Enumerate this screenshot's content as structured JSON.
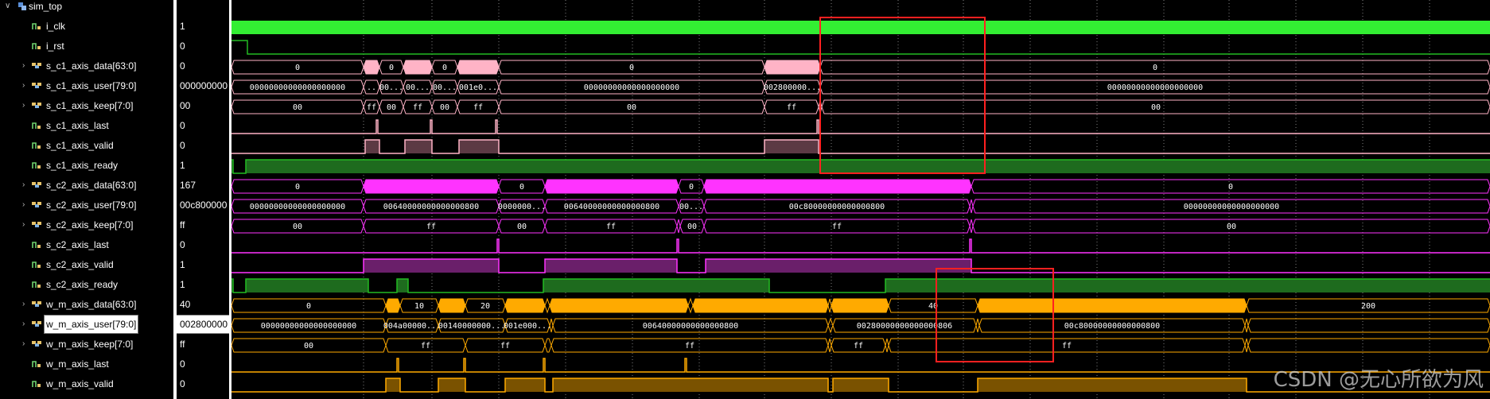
{
  "scope": {
    "name": "sim_top"
  },
  "signals": [
    {
      "name": "i_clk",
      "value": "1",
      "type": "bit",
      "expandable": false
    },
    {
      "name": "i_rst",
      "value": "0",
      "type": "bit",
      "expandable": false
    },
    {
      "name": "s_c1_axis_data[63:0]",
      "value": "0",
      "type": "bus",
      "expandable": true
    },
    {
      "name": "s_c1_axis_user[79:0]",
      "value": "000000000",
      "type": "bus",
      "expandable": true
    },
    {
      "name": "s_c1_axis_keep[7:0]",
      "value": "00",
      "type": "bus",
      "expandable": true
    },
    {
      "name": "s_c1_axis_last",
      "value": "0",
      "type": "bit",
      "expandable": false
    },
    {
      "name": "s_c1_axis_valid",
      "value": "0",
      "type": "bit",
      "expandable": false
    },
    {
      "name": "s_c1_axis_ready",
      "value": "1",
      "type": "bit",
      "expandable": false
    },
    {
      "name": "s_c2_axis_data[63:0]",
      "value": "167",
      "type": "bus",
      "expandable": true
    },
    {
      "name": "s_c2_axis_user[79:0]",
      "value": "00c800000",
      "type": "bus",
      "expandable": true
    },
    {
      "name": "s_c2_axis_keep[7:0]",
      "value": "ff",
      "type": "bus",
      "expandable": true
    },
    {
      "name": "s_c2_axis_last",
      "value": "0",
      "type": "bit",
      "expandable": false
    },
    {
      "name": "s_c2_axis_valid",
      "value": "1",
      "type": "bit",
      "expandable": false
    },
    {
      "name": "s_c2_axis_ready",
      "value": "1",
      "type": "bit",
      "expandable": false
    },
    {
      "name": "w_m_axis_data[63:0]",
      "value": "40",
      "type": "bus",
      "expandable": true
    },
    {
      "name": "w_m_axis_user[79:0]",
      "value": "002800000",
      "type": "bus",
      "expandable": true,
      "selected": true
    },
    {
      "name": "w_m_axis_keep[7:0]",
      "value": "ff",
      "type": "bus",
      "expandable": true
    },
    {
      "name": "w_m_axis_last",
      "value": "0",
      "type": "bit",
      "expandable": false
    },
    {
      "name": "w_m_axis_valid",
      "value": "0",
      "type": "bit",
      "expandable": false
    }
  ],
  "colors": {
    "clk": "#33ee33",
    "green": "#22bb22",
    "green_fill": "#1e6b1e",
    "pink": "#ffb3c6",
    "pink_fill": "#5c3a44",
    "magenta": "#ff33ff",
    "magenta_fill": "#6a1f6a",
    "orange": "#ffaa00",
    "orange_fill": "#7a5200",
    "grid": "#808080",
    "highlight": "#ff2020"
  },
  "waves": [
    {
      "row": 0,
      "kind": "clock"
    },
    {
      "row": 1,
      "kind": "bit",
      "color": "green",
      "segs": [
        [
          0,
          20,
          1
        ],
        [
          20,
          1582,
          0
        ]
      ]
    },
    {
      "row": 2,
      "kind": "bus",
      "color": "pink",
      "segs": [
        [
          0,
          166,
          "0",
          0
        ],
        [
          166,
          186,
          "",
          1
        ],
        [
          186,
          216,
          "0",
          0
        ],
        [
          216,
          252,
          "",
          1
        ],
        [
          252,
          284,
          "0",
          0
        ],
        [
          284,
          336,
          "",
          1
        ],
        [
          336,
          670,
          "0",
          0
        ],
        [
          670,
          740,
          "",
          1
        ],
        [
          740,
          1582,
          "0",
          0
        ]
      ]
    },
    {
      "row": 3,
      "kind": "bus",
      "color": "pink",
      "segs": [
        [
          0,
          166,
          "00000000000000000000",
          0
        ],
        [
          166,
          186,
          "..",
          0
        ],
        [
          186,
          216,
          "00...",
          0
        ],
        [
          216,
          252,
          "00...",
          0
        ],
        [
          252,
          284,
          "00...",
          0
        ],
        [
          284,
          336,
          "001e0...",
          0
        ],
        [
          336,
          670,
          "00000000000000000000",
          0
        ],
        [
          670,
          740,
          "002800000...",
          0
        ],
        [
          740,
          1582,
          "00000000000000000000",
          0
        ]
      ]
    },
    {
      "row": 4,
      "kind": "bus",
      "color": "pink",
      "segs": [
        [
          0,
          166,
          "00",
          0
        ],
        [
          166,
          186,
          "ff",
          0
        ],
        [
          186,
          216,
          "00",
          0
        ],
        [
          216,
          252,
          "ff",
          0
        ],
        [
          252,
          284,
          "00",
          0
        ],
        [
          284,
          336,
          "ff",
          0
        ],
        [
          336,
          670,
          "00",
          0
        ],
        [
          670,
          738,
          "ff",
          0
        ],
        [
          738,
          742,
          "",
          0
        ],
        [
          742,
          1582,
          "00",
          0
        ]
      ]
    },
    {
      "row": 5,
      "kind": "bit",
      "color": "pink",
      "segs": [
        [
          0,
          182,
          0
        ],
        [
          182,
          184,
          1
        ],
        [
          184,
          250,
          0
        ],
        [
          250,
          252,
          1
        ],
        [
          252,
          332,
          0
        ],
        [
          332,
          334,
          1
        ],
        [
          334,
          736,
          0
        ],
        [
          736,
          738,
          1
        ],
        [
          738,
          1582,
          0
        ]
      ]
    },
    {
      "row": 6,
      "kind": "bit",
      "color": "pink",
      "fill": "pink_fill",
      "segs": [
        [
          0,
          168,
          0
        ],
        [
          168,
          186,
          1
        ],
        [
          186,
          218,
          0
        ],
        [
          218,
          252,
          1
        ],
        [
          252,
          286,
          0
        ],
        [
          286,
          336,
          1
        ],
        [
          336,
          670,
          0
        ],
        [
          670,
          738,
          1
        ],
        [
          738,
          1582,
          0
        ]
      ]
    },
    {
      "row": 7,
      "kind": "bit",
      "color": "green",
      "fill": "green_fill",
      "segs": [
        [
          0,
          2,
          1
        ],
        [
          2,
          18,
          0
        ],
        [
          18,
          1582,
          1
        ]
      ]
    },
    {
      "row": 8,
      "kind": "bus",
      "color": "magenta",
      "segs": [
        [
          0,
          166,
          "0",
          0
        ],
        [
          166,
          336,
          "",
          1
        ],
        [
          336,
          394,
          "0",
          0
        ],
        [
          394,
          562,
          "",
          1
        ],
        [
          562,
          594,
          "0",
          0
        ],
        [
          594,
          930,
          "",
          1
        ],
        [
          930,
          1582,
          "0",
          0
        ]
      ]
    },
    {
      "row": 9,
      "kind": "bus",
      "color": "magenta",
      "segs": [
        [
          0,
          166,
          "00000000000000000000",
          0
        ],
        [
          166,
          336,
          "00640000000000000800",
          0
        ],
        [
          336,
          394,
          "0000000...",
          0
        ],
        [
          394,
          562,
          "00640000000000000800",
          0
        ],
        [
          562,
          594,
          "00...",
          0
        ],
        [
          594,
          928,
          "00c80000000000000800",
          0
        ],
        [
          928,
          932,
          "",
          0
        ],
        [
          932,
          1582,
          "00000000000000000000",
          0
        ]
      ]
    },
    {
      "row": 10,
      "kind": "bus",
      "color": "magenta",
      "segs": [
        [
          0,
          166,
          "00",
          0
        ],
        [
          166,
          336,
          "ff",
          0
        ],
        [
          336,
          394,
          "00",
          0
        ],
        [
          394,
          560,
          "ff",
          0
        ],
        [
          560,
          564,
          "",
          0
        ],
        [
          564,
          594,
          "00",
          0
        ],
        [
          594,
          928,
          "ff",
          0
        ],
        [
          928,
          932,
          "",
          0
        ],
        [
          932,
          1582,
          "00",
          0
        ]
      ]
    },
    {
      "row": 11,
      "kind": "bit",
      "color": "magenta",
      "segs": [
        [
          0,
          334,
          0
        ],
        [
          334,
          336,
          1
        ],
        [
          336,
          560,
          0
        ],
        [
          560,
          562,
          1
        ],
        [
          562,
          928,
          0
        ],
        [
          928,
          930,
          1
        ],
        [
          930,
          1582,
          0
        ]
      ]
    },
    {
      "row": 12,
      "kind": "bit",
      "color": "magenta",
      "fill": "magenta_fill",
      "segs": [
        [
          0,
          166,
          0
        ],
        [
          166,
          336,
          1
        ],
        [
          336,
          394,
          0
        ],
        [
          394,
          560,
          1
        ],
        [
          560,
          596,
          0
        ],
        [
          596,
          930,
          1
        ],
        [
          930,
          1582,
          0
        ]
      ]
    },
    {
      "row": 13,
      "kind": "bit",
      "color": "green",
      "fill": "green_fill",
      "segs": [
        [
          0,
          2,
          1
        ],
        [
          2,
          18,
          0
        ],
        [
          18,
          172,
          1
        ],
        [
          172,
          208,
          0
        ],
        [
          208,
          222,
          1
        ],
        [
          222,
          392,
          0
        ],
        [
          392,
          676,
          1
        ],
        [
          676,
          822,
          0
        ],
        [
          822,
          1582,
          1
        ]
      ]
    },
    {
      "row": 14,
      "kind": "bus",
      "color": "orange",
      "segs": [
        [
          0,
          194,
          "0",
          0
        ],
        [
          194,
          212,
          "",
          1
        ],
        [
          212,
          260,
          "10",
          0
        ],
        [
          260,
          294,
          "",
          1
        ],
        [
          294,
          344,
          "20",
          0
        ],
        [
          344,
          394,
          "",
          1
        ],
        [
          394,
          400,
          "",
          0
        ],
        [
          400,
          574,
          "",
          1
        ],
        [
          574,
          580,
          "",
          0
        ],
        [
          580,
          750,
          "",
          1
        ],
        [
          750,
          754,
          "",
          0
        ],
        [
          754,
          826,
          "",
          1
        ],
        [
          826,
          938,
          "40",
          0
        ],
        [
          938,
          1276,
          "",
          1
        ],
        [
          1276,
          1582,
          "200",
          0
        ]
      ]
    },
    {
      "row": 15,
      "kind": "bus",
      "color": "orange",
      "segs": [
        [
          0,
          194,
          "00000000000000000000",
          0
        ],
        [
          194,
          260,
          "004a00000...",
          0
        ],
        [
          260,
          344,
          "00140000000...",
          0
        ],
        [
          344,
          400,
          "001e000...",
          0
        ],
        [
          400,
          404,
          "",
          0
        ],
        [
          404,
          750,
          "00640000000000000800",
          0
        ],
        [
          750,
          756,
          "",
          0
        ],
        [
          756,
          936,
          "00280000000000000806",
          0
        ],
        [
          936,
          940,
          "",
          0
        ],
        [
          940,
          1274,
          "00c80000000000000800",
          0
        ],
        [
          1274,
          1278,
          "",
          0
        ],
        [
          1278,
          1582,
          "",
          0
        ]
      ]
    },
    {
      "row": 16,
      "kind": "bus",
      "color": "orange",
      "segs": [
        [
          0,
          194,
          "00",
          0
        ],
        [
          194,
          294,
          "ff",
          0
        ],
        [
          294,
          394,
          "ff",
          0
        ],
        [
          394,
          402,
          "",
          0
        ],
        [
          402,
          750,
          "ff",
          0
        ],
        [
          750,
          754,
          "",
          0
        ],
        [
          754,
          822,
          "ff",
          0
        ],
        [
          822,
          826,
          "",
          0
        ],
        [
          826,
          1274,
          "ff",
          0
        ],
        [
          1274,
          1278,
          "",
          0
        ],
        [
          1278,
          1582,
          "",
          0
        ]
      ]
    },
    {
      "row": 17,
      "kind": "bit",
      "color": "orange",
      "segs": [
        [
          0,
          208,
          0
        ],
        [
          208,
          210,
          1
        ],
        [
          210,
          292,
          0
        ],
        [
          292,
          294,
          1
        ],
        [
          294,
          392,
          0
        ],
        [
          392,
          394,
          1
        ],
        [
          394,
          570,
          0
        ],
        [
          570,
          572,
          1
        ],
        [
          572,
          1582,
          0
        ]
      ]
    },
    {
      "row": 18,
      "kind": "bit",
      "color": "orange",
      "fill": "orange_fill",
      "segs": [
        [
          0,
          194,
          0
        ],
        [
          194,
          212,
          1
        ],
        [
          212,
          260,
          0
        ],
        [
          260,
          294,
          1
        ],
        [
          294,
          344,
          0
        ],
        [
          344,
          394,
          1
        ],
        [
          394,
          404,
          0
        ],
        [
          404,
          750,
          1
        ],
        [
          750,
          756,
          0
        ],
        [
          756,
          826,
          1
        ],
        [
          826,
          938,
          0
        ],
        [
          938,
          1276,
          1
        ],
        [
          1276,
          1582,
          0
        ]
      ]
    }
  ],
  "grid_x": [
    166,
    252,
    336,
    420,
    504,
    588,
    670,
    754,
    838,
    920,
    1004,
    1088,
    1172,
    1254,
    1338,
    1422,
    1506
  ],
  "highlights": [],
  "watermark": "CSDN @无心所欲为风"
}
